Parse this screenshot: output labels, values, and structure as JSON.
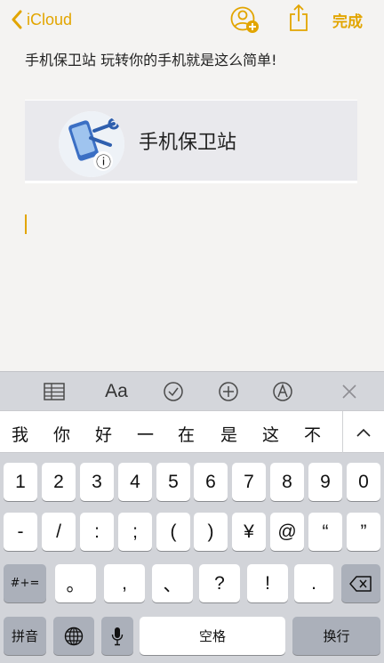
{
  "nav": {
    "back_label": "iCloud",
    "done_label": "完成",
    "accent_color": "#e2a500",
    "icons": [
      "chevron-left-icon",
      "add-person-icon",
      "share-icon"
    ]
  },
  "note": {
    "text": "手机保卫站 玩转你的手机就是这么简单!",
    "link_card_title": "手机保卫站"
  },
  "format_bar": {
    "icons": [
      "table-icon",
      "text-format-icon",
      "checklist-icon",
      "add-icon",
      "markup-icon",
      "close-icon"
    ],
    "text_format_label": "Aa"
  },
  "candidates": [
    "我",
    "你",
    "好",
    "一",
    "在",
    "是",
    "这",
    "不"
  ],
  "keyboard": {
    "row1": [
      "1",
      "2",
      "3",
      "4",
      "5",
      "6",
      "7",
      "8",
      "9",
      "0"
    ],
    "row2": [
      "-",
      "/",
      ":",
      ";",
      "(",
      ")",
      "¥",
      "@",
      "“",
      "”"
    ],
    "row3_left": "#+=",
    "row3": [
      "。",
      ",",
      "、",
      "?",
      "!",
      "."
    ],
    "pinyin": "拼音",
    "space": "空格",
    "return": "换行"
  }
}
